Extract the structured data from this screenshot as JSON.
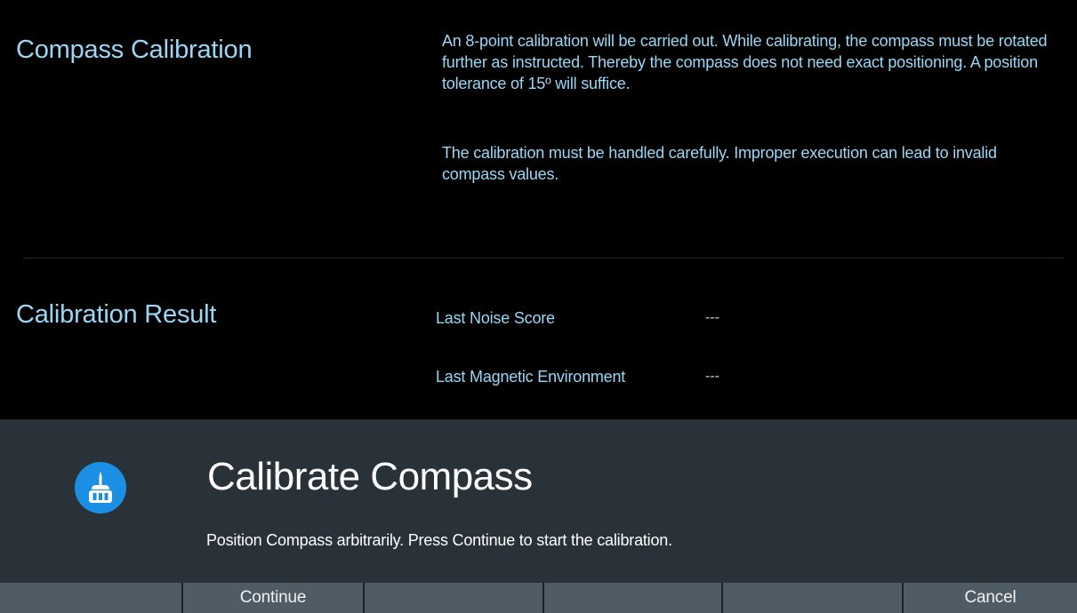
{
  "compass_calibration": {
    "title": "Compass Calibration",
    "paragraph_1": "An 8-point calibration will be carried out. While calibrating, the compass must be rotated further as instructed. Thereby the compass does not need exact positioning. A position tolerance of 15º will suffice.",
    "paragraph_2": "The calibration must be handled carefully. Improper execution can lead to invalid compass values."
  },
  "calibration_result": {
    "title": "Calibration Result",
    "noise_score_label": "Last Noise Score",
    "noise_score_value": "---",
    "magnetic_env_label": "Last Magnetic Environment",
    "magnetic_env_value": "---"
  },
  "dialog": {
    "icon": "compass-calibrate-icon",
    "title": "Calibrate Compass",
    "message": "Position Compass arbitrarily. Press Continue to start the calibration."
  },
  "softkeys": [
    "",
    "Continue",
    "",
    "",
    "",
    "Cancel"
  ],
  "colors": {
    "text_accent": "#9cd6f5",
    "dialog_bg": "#293238",
    "softkey_bg": "#4f5c66",
    "icon_bg": "#1b8fe4"
  }
}
